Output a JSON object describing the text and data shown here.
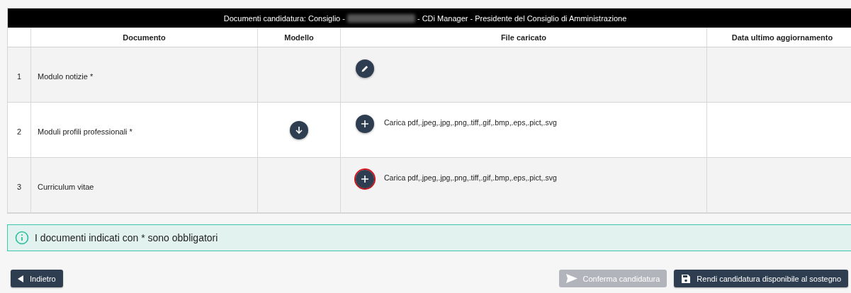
{
  "table": {
    "title_start": "Documenti candidatura: Consiglio -",
    "title_end": "- CDi Manager - Presidente del Consiglio di Amministrazione",
    "columns": [
      "Documento",
      "Modello",
      "File caricato",
      "Data ultimo aggiornamento"
    ],
    "rows": [
      {
        "number": "1",
        "document": "Modulo notizie *",
        "model_download": false,
        "file_action": {
          "kind": "edit",
          "highlighted": false
        }
      },
      {
        "number": "2",
        "document": "Moduli profili professionali *",
        "model_download": true,
        "file_action": {
          "kind": "upload",
          "highlighted": false,
          "hint": "Carica pdf,.jpeg,.jpg,.png,.tiff,.gif,.bmp,.eps,.pict,.svg"
        }
      },
      {
        "number": "3",
        "document": "Curriculum vitae",
        "model_download": false,
        "file_action": {
          "kind": "upload",
          "highlighted": true,
          "hint": "Carica pdf,.jpeg,.jpg,.png,.tiff,.gif,.bmp,.eps,.pict,.svg"
        }
      }
    ]
  },
  "notice": "I documenti indicati con * sono obbligatori",
  "buttons": [
    {
      "kind": "back",
      "label": "Indietro",
      "disabled": false
    },
    {
      "kind": "confirm",
      "label": "Conferma candidatura",
      "disabled": true
    },
    {
      "kind": "save",
      "label": "Rendi candidatura disponibile al sostegno",
      "disabled": false
    }
  ]
}
